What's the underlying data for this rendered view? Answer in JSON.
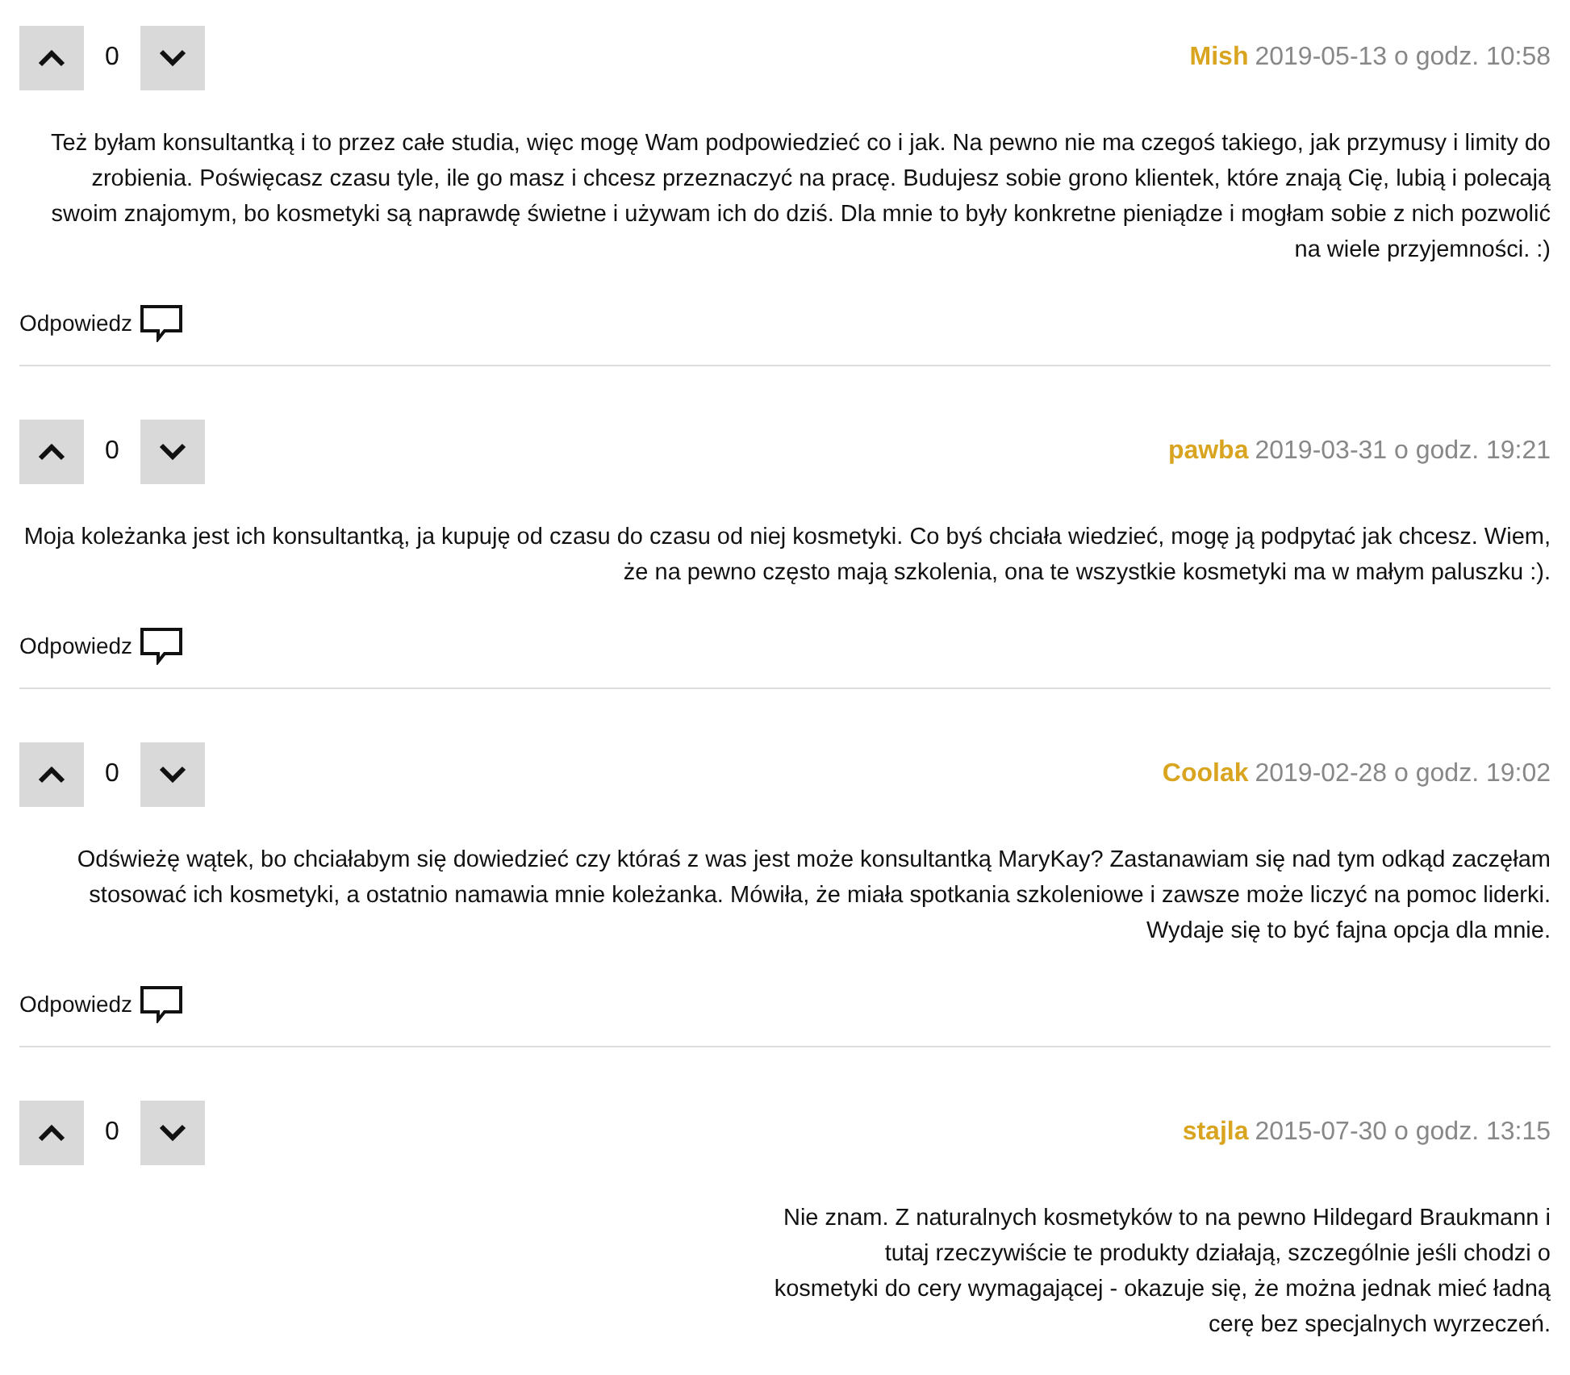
{
  "comments": [
    {
      "author": "Mish",
      "date": "2019-05-13 o godz. 10:58",
      "votes": "0",
      "text": "Też byłam konsultantką i to przez całe studia, więc mogę Wam podpowiedzieć co i jak. Na pewno nie ma czegoś takiego, jak przymusy i limity do zrobienia. Poświęcasz czasu tyle, ile go masz i chcesz przeznaczyć na pracę. Budujesz sobie grono klientek, które znają Cię, lubią i polecają swoim znajomym, bo kosmetyki są naprawdę świetne i używam ich do dziś. Dla mnie to były konkretne pieniądze i mogłam sobie z nich pozwolić na wiele przyjemności. :)",
      "reply": "Odpowiedz"
    },
    {
      "author": "pawba",
      "date": "2019-03-31 o godz. 19:21",
      "votes": "0",
      "text": "Moja koleżanka jest ich konsultantką, ja kupuję od czasu do czasu od niej kosmetyki. Co byś chciała wiedzieć, mogę ją podpytać jak chcesz. Wiem, że na pewno często mają szkolenia, ona te wszystkie kosmetyki ma w małym paluszku :).",
      "reply": "Odpowiedz"
    },
    {
      "author": "Coolak",
      "date": "2019-02-28 o godz. 19:02",
      "votes": "0",
      "text": "Odświeżę wątek, bo chciałabym się dowiedzieć czy któraś z was jest może konsultantką MaryKay? Zastanawiam się nad tym odkąd zaczęłam stosować ich kosmetyki, a ostatnio namawia mnie koleżanka. Mówiła, że miała spotkania szkoleniowe i zawsze może liczyć na pomoc liderki. Wydaje się to być fajna opcja dla mnie.",
      "reply": "Odpowiedz"
    },
    {
      "author": "stajla",
      "date": "2015-07-30 o godz. 13:15",
      "votes": "0",
      "text": "Nie znam. Z naturalnych kosmetyków to na pewno Hildegard Braukmann i\ntutaj rzeczywiście te produkty działają, szczególnie jeśli chodzi o\nkosmetyki do cery wymagającej - okazuje się, że można jednak mieć ładną\ncerę bez specjalnych wyrzeczeń."
    }
  ]
}
